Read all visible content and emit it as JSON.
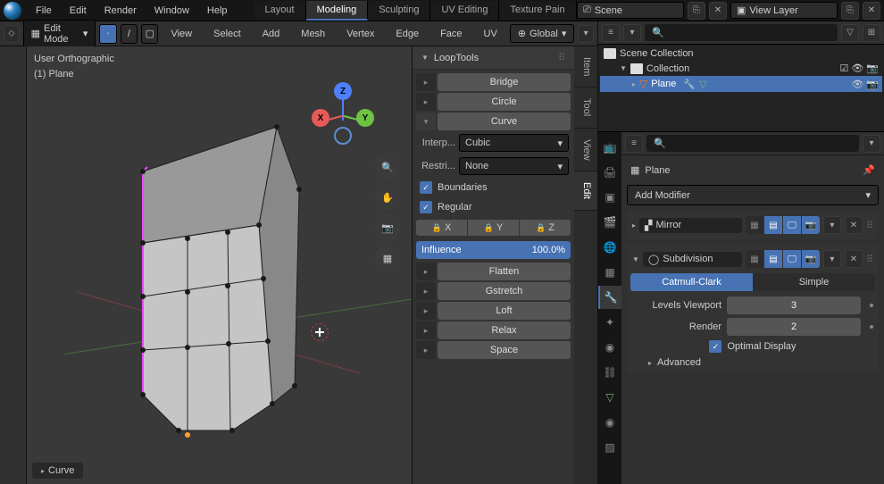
{
  "topmenu": {
    "file": "File",
    "edit": "Edit",
    "render": "Render",
    "window": "Window",
    "help": "Help"
  },
  "workspaces": {
    "layout": "Layout",
    "modeling": "Modeling",
    "sculpting": "Sculpting",
    "uv": "UV Editing",
    "texture": "Texture Pain"
  },
  "scene_field": "Scene",
  "viewlayer_field": "View Layer",
  "viewport_header": {
    "mode": "Edit Mode",
    "view": "View",
    "select": "Select",
    "add": "Add",
    "mesh": "Mesh",
    "vertex": "Vertex",
    "edge": "Edge",
    "face": "Face",
    "uv": "UV",
    "orientation": "Global"
  },
  "viewport_info": {
    "line1": "User Orthographic",
    "line2": "(1) Plane"
  },
  "viewport_status": "Curve",
  "gizmo": {
    "x": "X",
    "y": "Y",
    "z": "Z"
  },
  "looptools": {
    "title": "LoopTools",
    "bridge": "Bridge",
    "circle": "Circle",
    "curve": "Curve",
    "interp_label": "Interp...",
    "interp_value": "Cubic",
    "restri_label": "Restri...",
    "restri_value": "None",
    "boundaries": "Boundaries",
    "regular": "Regular",
    "x": "X",
    "y": "Y",
    "z": "Z",
    "influence_label": "Influence",
    "influence_value": "100.0%",
    "flatten": "Flatten",
    "gstretch": "Gstretch",
    "loft": "Loft",
    "relax": "Relax",
    "space": "Space"
  },
  "npanel_tabs": {
    "item": "Item",
    "tool": "Tool",
    "view": "View",
    "edit": "Edit"
  },
  "outliner": {
    "scene_collection": "Scene Collection",
    "collection": "Collection",
    "plane": "Plane"
  },
  "props": {
    "object_name": "Plane",
    "add_modifier": "Add Modifier",
    "mirror": "Mirror",
    "subdivision": "Subdivision",
    "catmull": "Catmull-Clark",
    "simple": "Simple",
    "levels_viewport_label": "Levels Viewport",
    "levels_viewport_value": "3",
    "render_label": "Render",
    "render_value": "2",
    "optimal_display": "Optimal Display",
    "advanced": "Advanced"
  }
}
